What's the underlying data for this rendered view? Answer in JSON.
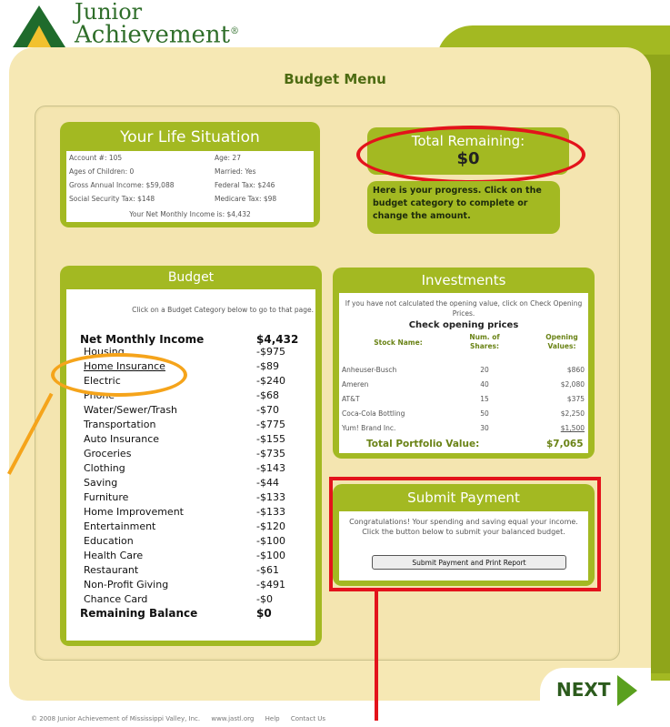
{
  "logo": {
    "line1": "Junior",
    "line2": "Achievement",
    "mark": "®"
  },
  "page_title": "Budget Menu",
  "life_situation": {
    "title": "Your Life Situation",
    "rows": [
      {
        "left": "Account #: 105",
        "right": "Age: 27"
      },
      {
        "left": "Ages of Children: 0",
        "right": "Married: Yes"
      },
      {
        "left": "Gross Annual Income: $59,088",
        "right": "Federal Tax: $246"
      },
      {
        "left": "Social Security Tax: $148",
        "right": "Medicare Tax: $98"
      }
    ],
    "net": "Your Net Monthly Income is: $4,432"
  },
  "total_remaining": {
    "label": "Total Remaining:",
    "value": "$0"
  },
  "progress_note": "Here is your progress. Click on the budget category to complete or change the amount.",
  "budget": {
    "title": "Budget",
    "hint": "Click on a Budget Category below to go to that page.",
    "rows": [
      {
        "label": "Net Monthly Income",
        "value": "$4,432"
      },
      {
        "label": "Housing",
        "value": "-$975"
      },
      {
        "label": "Home Insurance",
        "value": "-$89"
      },
      {
        "label": "Electric",
        "value": "-$240"
      },
      {
        "label": "Phone",
        "value": "-$68"
      },
      {
        "label": "Water/Sewer/Trash",
        "value": "-$70"
      },
      {
        "label": "Transportation",
        "value": "-$775"
      },
      {
        "label": "Auto Insurance",
        "value": "-$155"
      },
      {
        "label": "Groceries",
        "value": "-$735"
      },
      {
        "label": "Clothing",
        "value": "-$143"
      },
      {
        "label": "Saving",
        "value": "-$44"
      },
      {
        "label": "Furniture",
        "value": "-$133"
      },
      {
        "label": "Home Improvement",
        "value": "-$133"
      },
      {
        "label": "Entertainment",
        "value": "-$120"
      },
      {
        "label": "Education",
        "value": "-$100"
      },
      {
        "label": "Health Care",
        "value": "-$100"
      },
      {
        "label": "Restaurant",
        "value": "-$61"
      },
      {
        "label": "Non-Profit Giving",
        "value": "-$491"
      },
      {
        "label": "Chance Card",
        "value": "-$0"
      },
      {
        "label": "Remaining Balance",
        "value": "$0"
      }
    ]
  },
  "investments": {
    "title": "Investments",
    "hint": "If you have not calculated the opening value, click on Check Opening Prices.",
    "check_link": "Check opening prices",
    "headers": {
      "name": "Stock Name:",
      "shares": "Num. of Shares:",
      "values": "Opening Values:"
    },
    "rows": [
      {
        "name": "Anheuser-Busch",
        "shares": "20",
        "value": "$860"
      },
      {
        "name": "Ameren",
        "shares": "40",
        "value": "$2,080"
      },
      {
        "name": "AT&T",
        "shares": "15",
        "value": "$375"
      },
      {
        "name": "Coca-Cola Bottling",
        "shares": "50",
        "value": "$2,250"
      },
      {
        "name": "Yum! Brand Inc.",
        "shares": "30",
        "value": "$1,500"
      }
    ],
    "total_label": "Total Portfolio Value:",
    "total_value": "$7,065"
  },
  "submit": {
    "title": "Submit Payment",
    "text": "Congratulations! Your spending and saving equal your income. Click the button below to submit your balanced budget.",
    "button": "Submit Payment and Print Report"
  },
  "next_label": "NEXT",
  "footer": {
    "copyright": "© 2008 Junior Achievement of Mississippi Valley, Inc.",
    "site": "www.jastl.org",
    "help": "Help",
    "contact": "Contact Us"
  },
  "colors": {
    "green": "#a3b922",
    "cream": "#f6e8b4",
    "red_highlight": "#e3131b",
    "orange_highlight": "#f5a41b",
    "dark_green": "#2c5b1d"
  }
}
